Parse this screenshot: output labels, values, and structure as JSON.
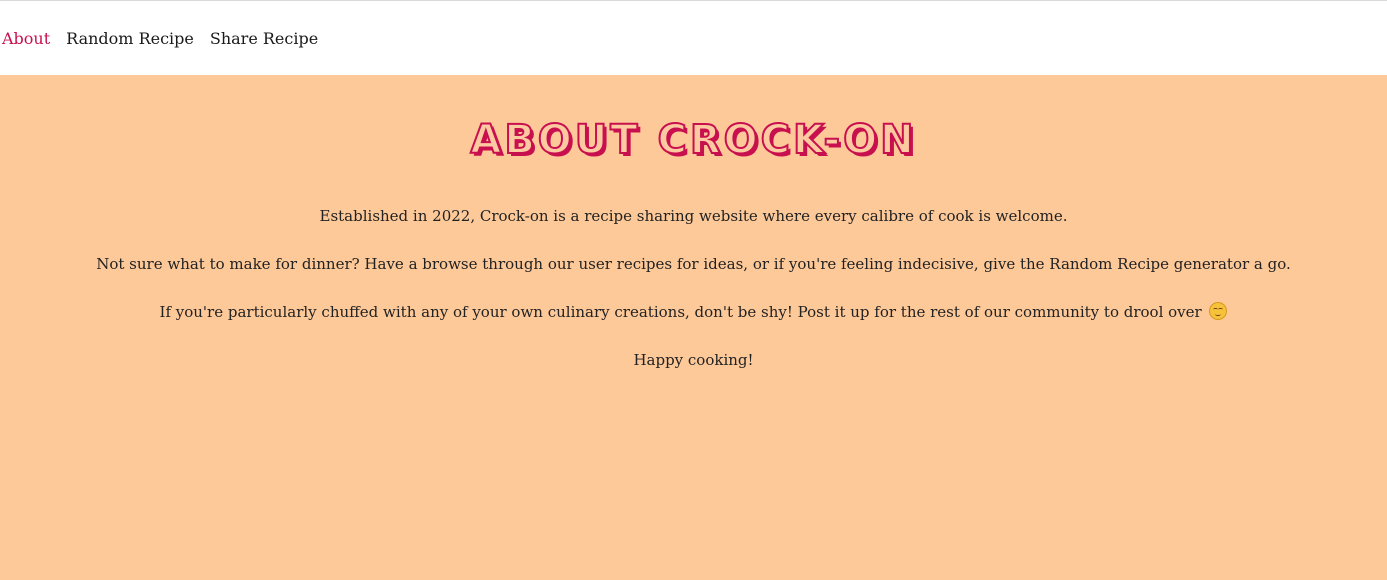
{
  "nav": {
    "items": [
      {
        "label": "About",
        "active": true
      },
      {
        "label": "Random Recipe",
        "active": false
      },
      {
        "label": "Share Recipe",
        "active": false
      }
    ]
  },
  "main": {
    "title": "About Crock-on",
    "paragraphs": [
      "Established in 2022, Crock-on is a recipe sharing website where every calibre of cook is welcome.",
      "Not sure what to make for dinner? Have a browse through our user recipes for ideas, or if you're feeling indecisive, give the Random Recipe generator a go.",
      "If you're particularly chuffed with any of your own culinary creations, don't be shy! Post it up for the rest of our community to drool over",
      "Happy cooking!"
    ],
    "emoji_icon": "relieved-face-icon"
  },
  "colors": {
    "accent": "#c8104f",
    "background": "#fec999",
    "text": "#222222"
  }
}
